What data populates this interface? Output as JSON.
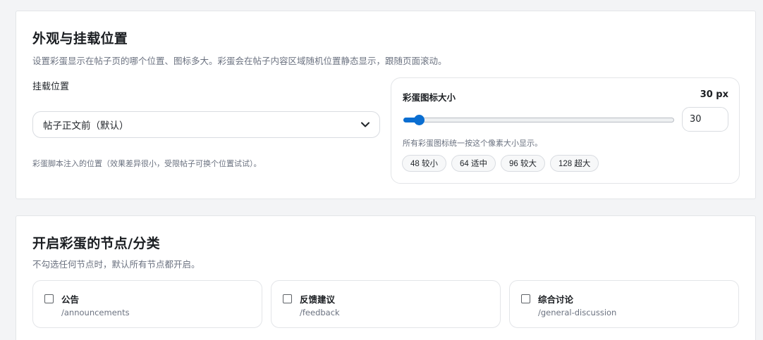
{
  "appearance": {
    "title": "外观与挂载位置",
    "description": "设置彩蛋显示在帖子页的哪个位置、图标多大。彩蛋会在帖子内容区域随机位置静态显示，跟随页面滚动。",
    "mount_label": "挂载位置",
    "mount_select_value": "帖子正文前（默认）",
    "mount_hint": "彩蛋脚本注入的位置（效果差异很小，受限帖子可换个位置试试）。",
    "icon_size": {
      "title": "彩蛋图标大小",
      "readout": "30 px",
      "value": 30,
      "min": 16,
      "max": 256,
      "input_value": "30",
      "hint": "所有彩蛋图标统一按这个像素大小显示。",
      "presets": [
        "48 较小",
        "64 适中",
        "96 较大",
        "128 超大"
      ],
      "accent_color": "#0a6ed1"
    }
  },
  "nodes": {
    "title": "开启彩蛋的节点/分类",
    "description": "不勾选任何节点时，默认所有节点都开启。",
    "items": [
      {
        "name": "公告",
        "slug": "/announcements",
        "checked": false
      },
      {
        "name": "反馈建议",
        "slug": "/feedback",
        "checked": false
      },
      {
        "name": "综合讨论",
        "slug": "/general-discussion",
        "checked": false
      }
    ]
  }
}
